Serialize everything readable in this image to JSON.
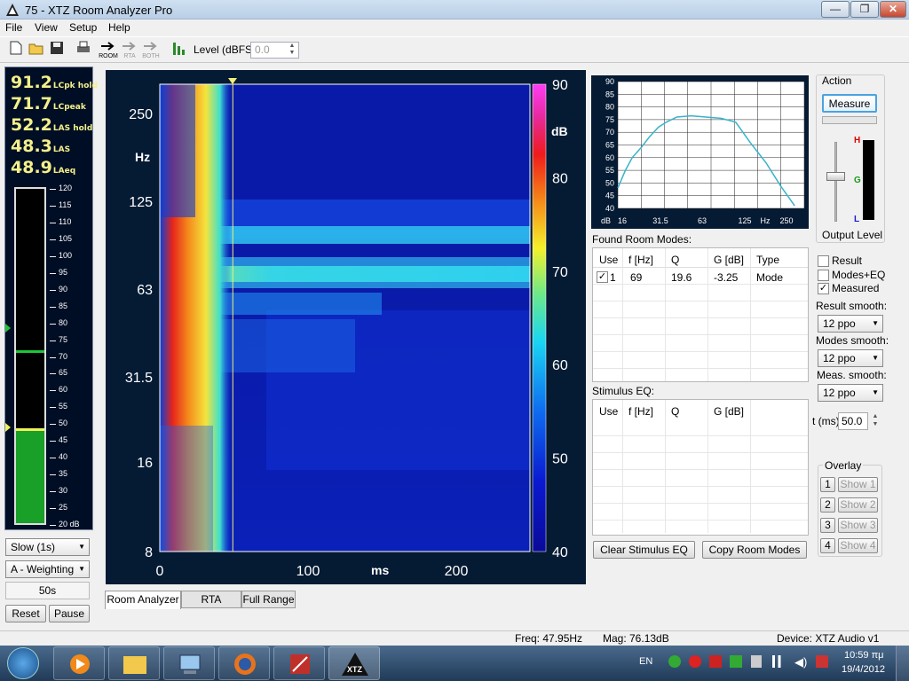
{
  "window": {
    "title": "75 - XTZ Room Analyzer Pro"
  },
  "menu": [
    "File",
    "View",
    "Setup",
    "Help"
  ],
  "toolbar": {
    "buttons": [
      "new-icon",
      "open-icon",
      "save-icon",
      "print-icon"
    ],
    "mode_buttons": [
      "ROOM",
      "RTA",
      "BOTH"
    ],
    "level_label": "Level (dBFS)",
    "level_value": "0.0"
  },
  "meter": {
    "readings": [
      {
        "value": "91.2",
        "label": "LCpk hold"
      },
      {
        "value": "71.7",
        "label": "LCpeak"
      },
      {
        "value": "52.2",
        "label": "LAS hold"
      },
      {
        "value": "48.3",
        "label": "LAS"
      },
      {
        "value": "48.9",
        "label": "LAeq"
      }
    ],
    "scale": [
      "120",
      "115",
      "110",
      "105",
      "100",
      "95",
      "90",
      "85",
      "80",
      "75",
      "70",
      "65",
      "60",
      "55",
      "50",
      "45",
      "40",
      "35",
      "30",
      "25",
      "20 dB"
    ],
    "fill_level_db": 48.3,
    "peak_hold_db": 71.7
  },
  "left_controls": {
    "speed": "Slow (1s)",
    "weighting": "A - Weighting",
    "duration": "50s",
    "reset": "Reset",
    "pause": "Pause"
  },
  "spectrogram": {
    "y_ticks": [
      "250",
      "125",
      "63",
      "31.5",
      "16",
      "8"
    ],
    "y_unit": "Hz",
    "x_ticks": [
      "0",
      "100",
      "200"
    ],
    "x_unit": "ms",
    "colorbar_ticks": [
      "90",
      "80",
      "70",
      "60",
      "50",
      "40"
    ],
    "colorbar_unit": "dB",
    "marker_time_ms": 50
  },
  "freq_response": {
    "y_ticks": [
      "90",
      "85",
      "80",
      "75",
      "70",
      "65",
      "60",
      "55",
      "50",
      "45",
      "40"
    ],
    "x_ticks": [
      "16",
      "31.5",
      "63",
      "125",
      "Hz",
      "250"
    ],
    "y_unit": "dB",
    "curve_color": "#38b3c9"
  },
  "room_modes": {
    "title": "Found Room Modes:",
    "columns": [
      "Use",
      "f [Hz]",
      "Q",
      "G [dB]",
      "Type"
    ],
    "rows": [
      [
        "1",
        "69",
        "19.6",
        "-3.25",
        "Mode"
      ]
    ]
  },
  "stimulus_eq": {
    "title": "Stimulus EQ:",
    "columns": [
      "Use",
      "f [Hz]",
      "Q",
      "G [dB]"
    ]
  },
  "buttons": {
    "clear_eq": "Clear Stimulus EQ",
    "copy_modes": "Copy Room Modes"
  },
  "action": {
    "title": "Action",
    "measure": "Measure",
    "output_level": "Output Level",
    "level_labels": [
      "H",
      "G",
      "L"
    ]
  },
  "display": {
    "result": "Result",
    "modes_eq": "Modes+EQ",
    "measured": "Measured",
    "result_smooth_label": "Result smooth:",
    "result_smooth": "12 ppo",
    "modes_smooth_label": "Modes smooth:",
    "modes_smooth": "12 ppo",
    "meas_smooth_label": "Meas. smooth:",
    "meas_smooth": "12 ppo",
    "t_label": "t (ms)",
    "t_value": "50.0"
  },
  "overlay": {
    "title": "Overlay",
    "items": [
      {
        "num": "1",
        "label": "Show 1"
      },
      {
        "num": "2",
        "label": "Show 2"
      },
      {
        "num": "3",
        "label": "Show 3"
      },
      {
        "num": "4",
        "label": "Show 4"
      }
    ]
  },
  "tabs": [
    "Room Analyzer",
    "RTA",
    "Full Range"
  ],
  "status": {
    "freq": "Freq: 47.95Hz",
    "mag": "Mag: 76.13dB",
    "device": "Device: XTZ Audio v1"
  },
  "taskbar": {
    "lang": "EN",
    "time": "10:59 πμ",
    "date": "19/4/2012",
    "app_label": "XTZ"
  }
}
